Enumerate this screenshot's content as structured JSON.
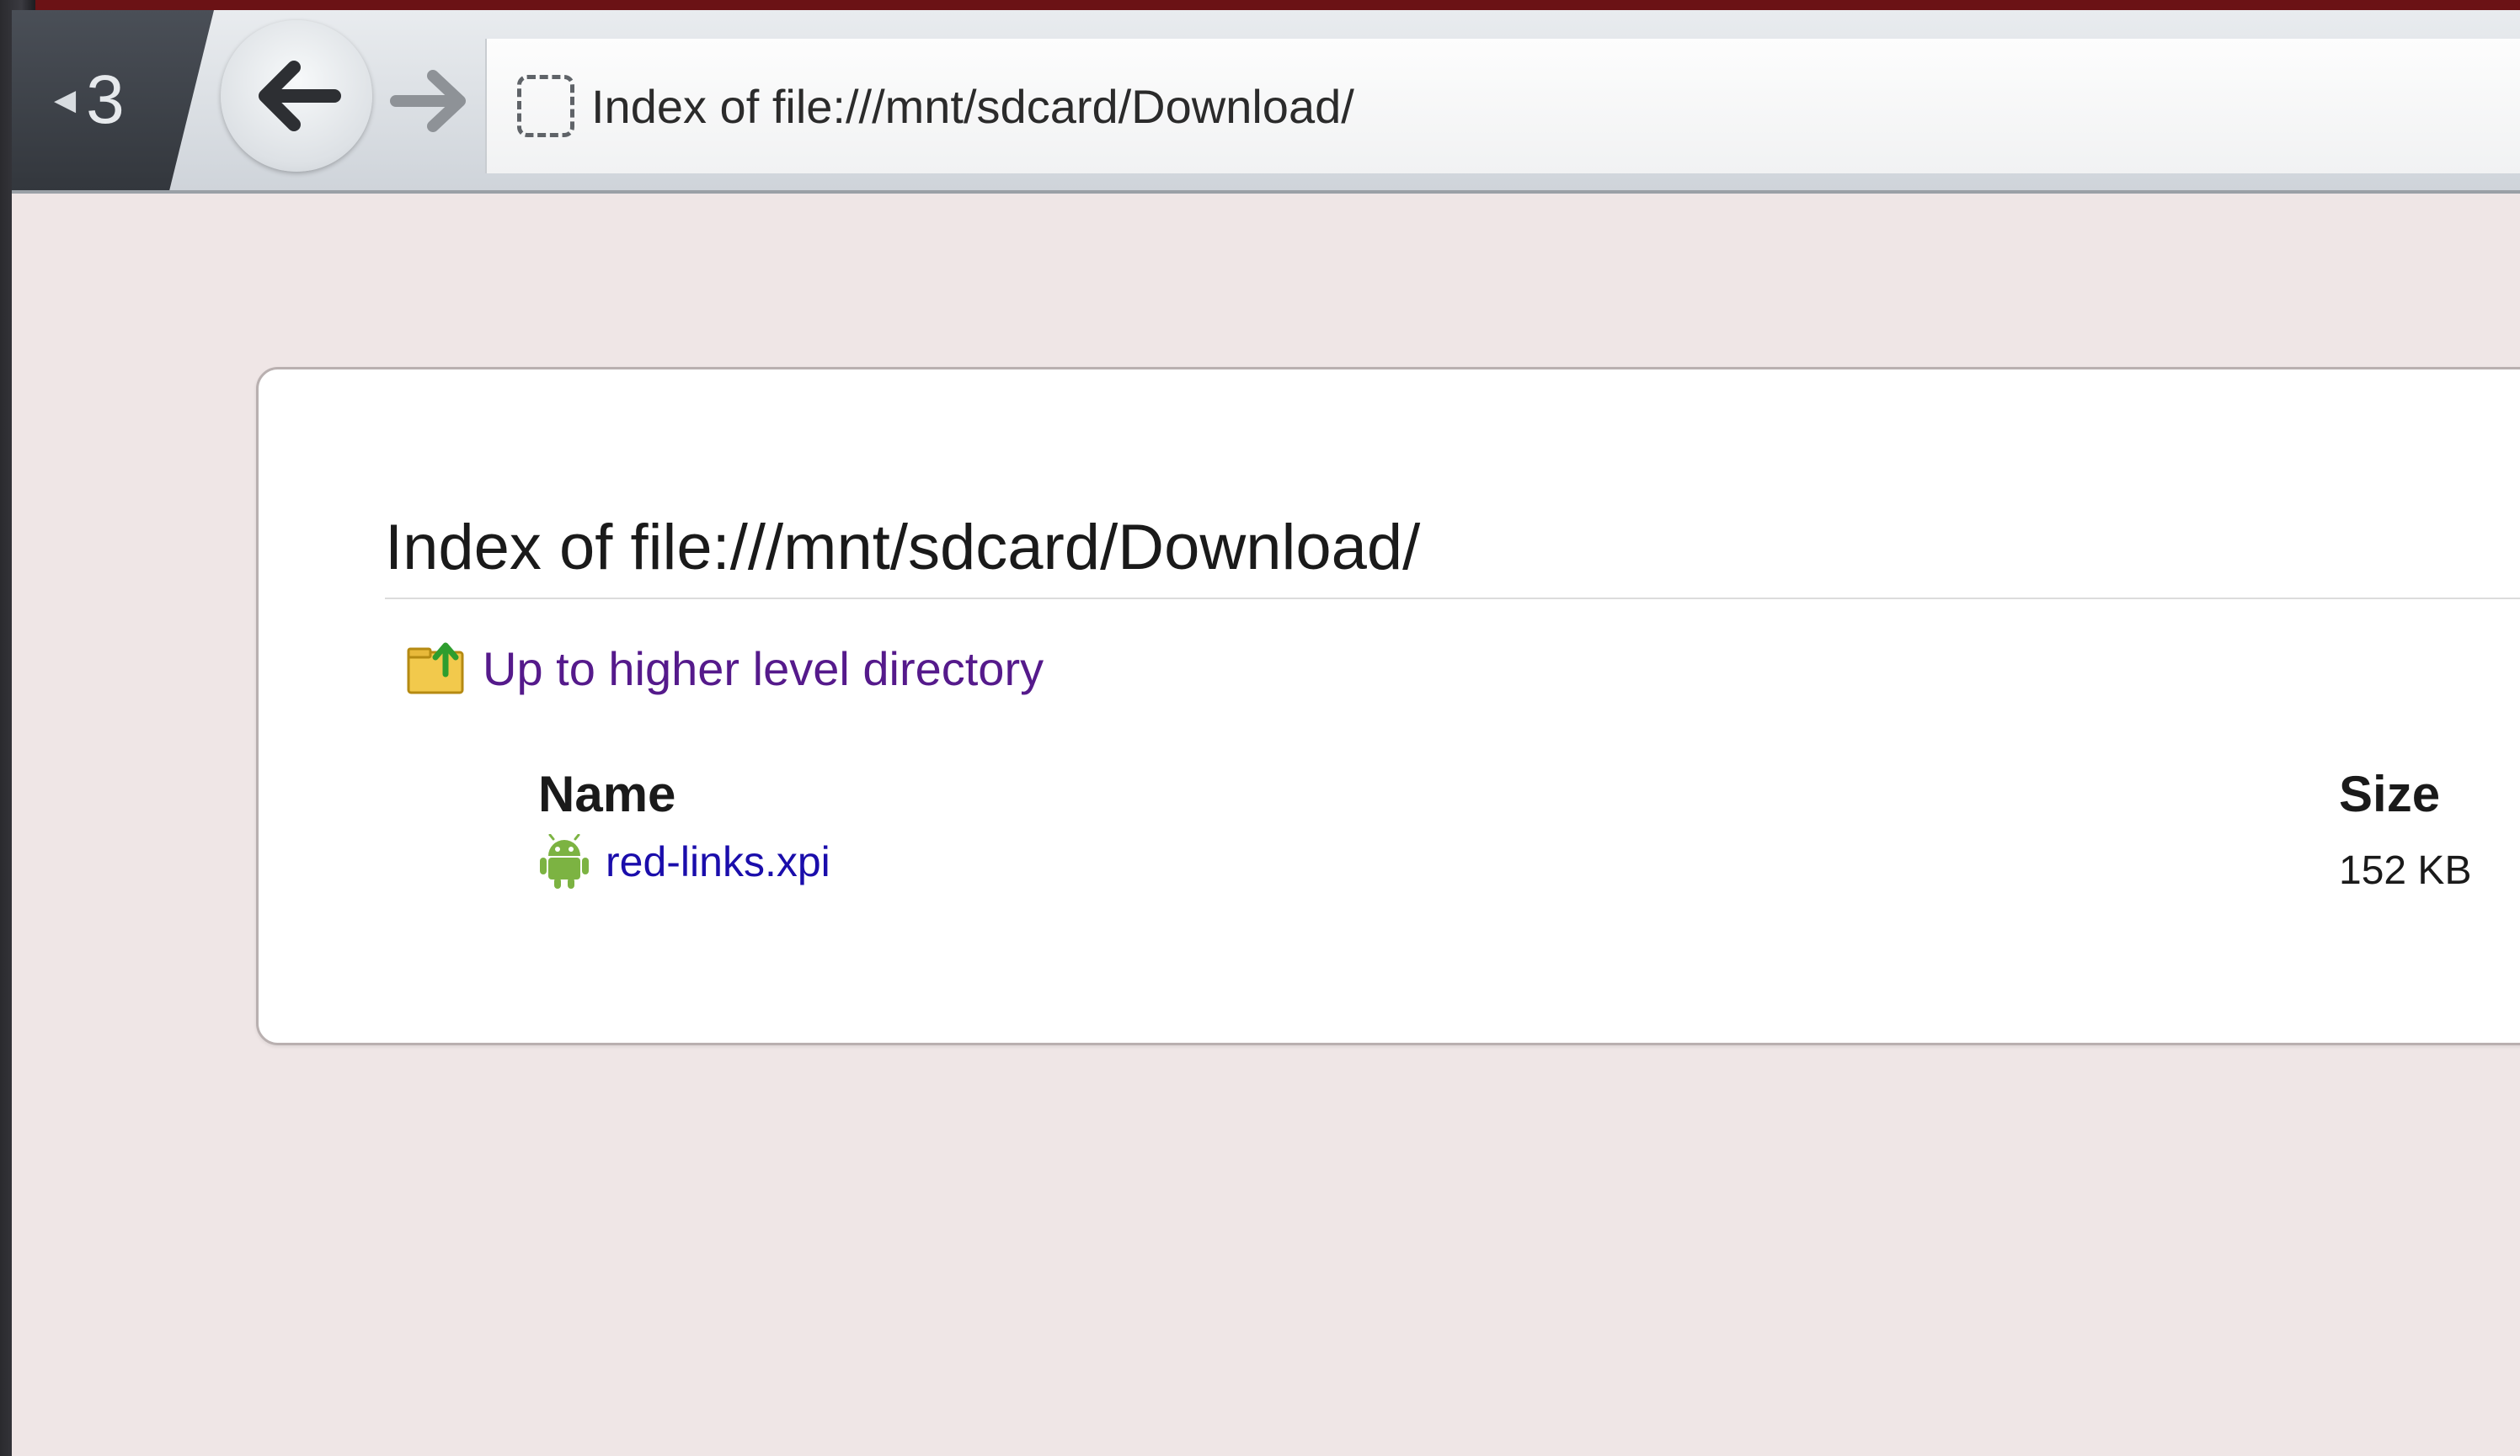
{
  "browser": {
    "tab_count": "3",
    "url": "Index of file:///mnt/sdcard/Download/"
  },
  "page": {
    "heading": "Index of file:///mnt/sdcard/Download/",
    "up_link_label": "Up to higher level directory",
    "columns": {
      "name": "Name",
      "size": "Size"
    },
    "files": [
      {
        "name": "red-links.xpi",
        "size": "152 KB",
        "icon": "android-icon"
      }
    ]
  },
  "colors": {
    "visited_link": "#551a8b",
    "link": "#1a0dab",
    "page_background": "#efe6e6"
  }
}
